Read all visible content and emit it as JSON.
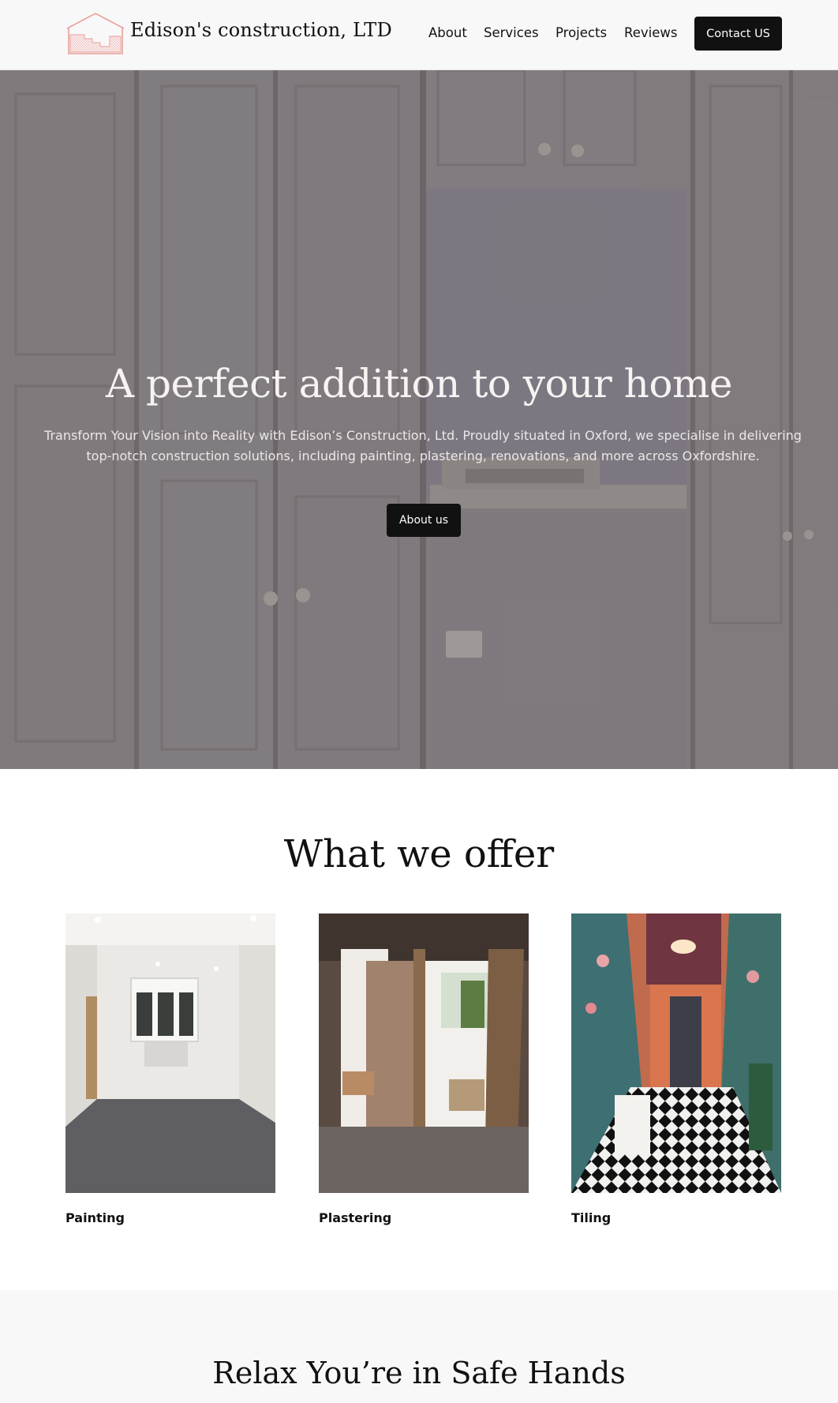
{
  "header": {
    "brand": "Edison's construction, LTD",
    "nav": [
      {
        "label": "About"
      },
      {
        "label": "Services"
      },
      {
        "label": "Projects"
      },
      {
        "label": "Reviews"
      }
    ],
    "contact_label": "Contact US"
  },
  "hero": {
    "title": "A perfect addition to your home",
    "text": "Transform Your Vision into Reality with Edison’s Construction, Ltd. Proudly situated in Oxford, we specialise in delivering top-notch construction solutions, including painting, plastering, renovations, and more across Oxfordshire.",
    "button_label": "About us"
  },
  "offer": {
    "title": "What we offer",
    "cards": [
      {
        "label": "Painting"
      },
      {
        "label": "Plastering"
      },
      {
        "label": "Tiling"
      }
    ]
  },
  "safe": {
    "title": "Relax You’re in Safe Hands"
  },
  "colors": {
    "accent": "#e9a19d",
    "button": "#111111",
    "header_bg": "#f8f8f8"
  }
}
